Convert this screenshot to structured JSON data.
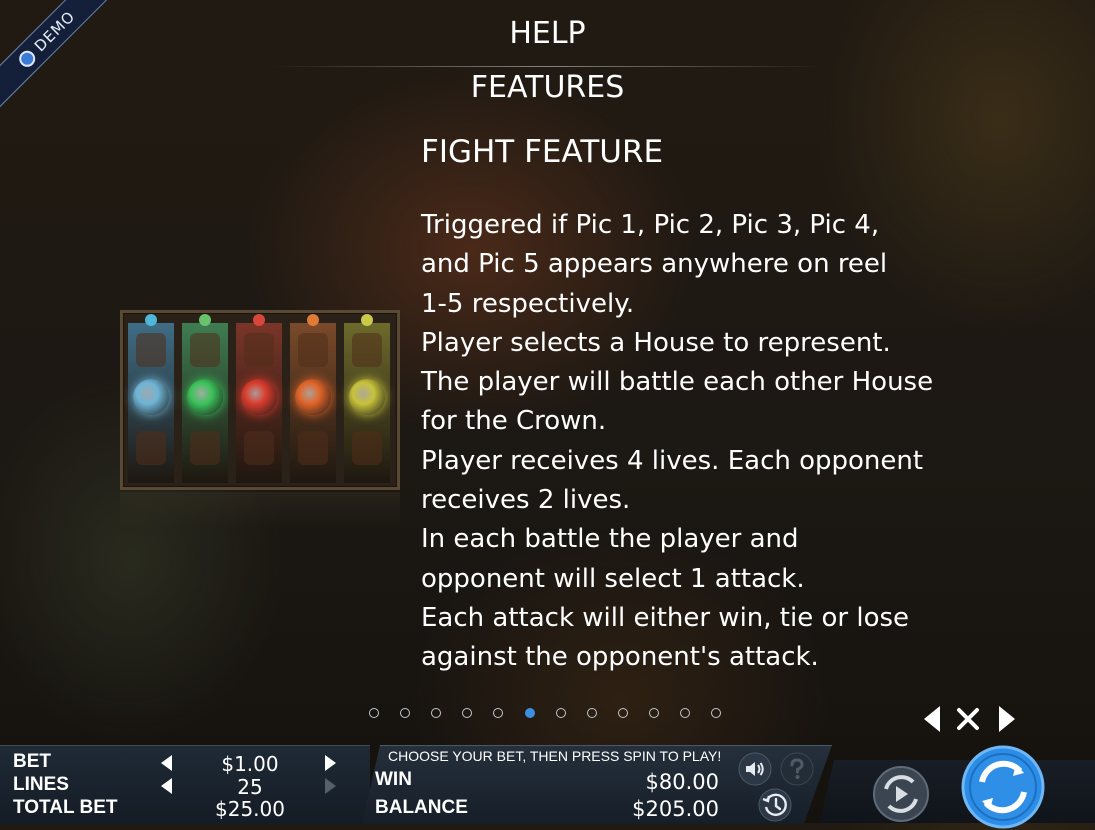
{
  "badge": {
    "label": "DEMO",
    "logo_icon": "g-logo-icon"
  },
  "header": {
    "help_title": "HELP",
    "section_title": "FEATURES"
  },
  "feature": {
    "heading": "FIGHT FEATURE",
    "lines": [
      "Triggered if Pic 1, Pic 2, Pic 3, Pic 4,",
      "and Pic 5 appears anywhere on reel",
      "1-5 respectively.",
      "Player selects a House to represent.",
      "The player will battle each other House",
      "for the Crown.",
      "Player receives 4 lives. Each opponent",
      "receives 2 lives.",
      "In each battle the player and",
      "opponent will select 1 attack.",
      "Each attack will either win, tie or lose",
      "against the opponent's attack."
    ]
  },
  "preview": {
    "reels": [
      {
        "color": "#3f6d86",
        "gem": "#4fb7d9",
        "symbol": "#6fb4d6"
      },
      {
        "color": "#3f7d52",
        "gem": "#69c36b",
        "symbol": "#3cc25a"
      },
      {
        "color": "#7a3528",
        "gem": "#d9473a",
        "symbol": "#d93b2c"
      },
      {
        "color": "#7a4a2a",
        "gem": "#e07a35",
        "symbol": "#e06428"
      },
      {
        "color": "#6d6a2c",
        "gem": "#c9c94a",
        "symbol": "#c8c23a"
      }
    ]
  },
  "pager": {
    "total": 12,
    "active_index": 5
  },
  "nav": {
    "prev_icon": "chevron-left-icon",
    "close_icon": "close-icon",
    "next_icon": "chevron-right-icon"
  },
  "bottom_bar": {
    "bet_label": "BET",
    "bet_value": "$1.00",
    "lines_label": "LINES",
    "lines_value": "25",
    "total_bet_label": "TOTAL BET",
    "total_bet_value": "$25.00",
    "prompt": "CHOOSE YOUR BET, THEN PRESS SPIN TO PLAY!",
    "win_label": "WIN",
    "win_value": "$80.00",
    "balance_label": "BALANCE",
    "balance_value": "$205.00"
  },
  "colors": {
    "accent": "#3f8fe0",
    "spin": "#2f8fe6"
  }
}
